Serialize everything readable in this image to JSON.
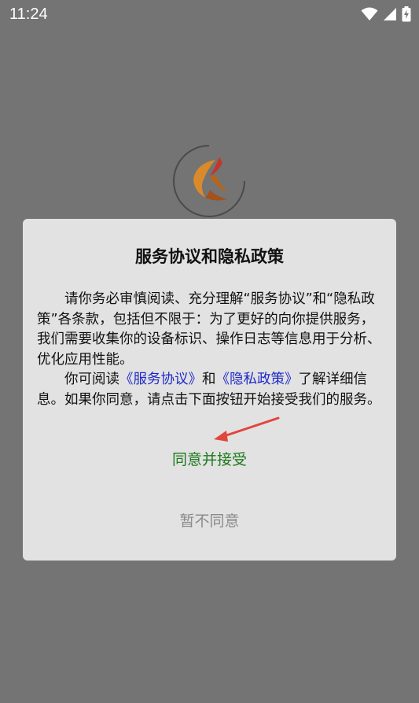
{
  "status_bar": {
    "time": "11:24",
    "icons": [
      "wifi-icon",
      "cellular-signal-icon",
      "battery-charging-icon"
    ]
  },
  "splash": {
    "logo": "phoenix-logo-icon"
  },
  "dialog": {
    "title": "服务协议和隐私政策",
    "paragraph1": "请你务必审慎阅读、充分理解“服务协议”和“隐私政策”各条款，包括但不限于：为了更好的向你提供服务，我们需要收集你的设备标识、操作日志等信息用于分析、优化应用性能。",
    "paragraph2_prefix": "你可阅读",
    "service_link": "《服务协议》",
    "paragraph2_and": "和",
    "privacy_link": "《隐私政策》",
    "paragraph2_suffix": "了解详细信息。如果你同意，请点击下面按钮开始接受我们的服务。",
    "accept_label": "同意并接受",
    "decline_label": "暂不同意"
  },
  "colors": {
    "backdrop": "#747474",
    "dialog_bg": "#e2e2e2",
    "link": "#1e29c8",
    "accept": "#1c7a1c",
    "decline": "#8a8a8a",
    "annotation_arrow": "#e0463c"
  }
}
